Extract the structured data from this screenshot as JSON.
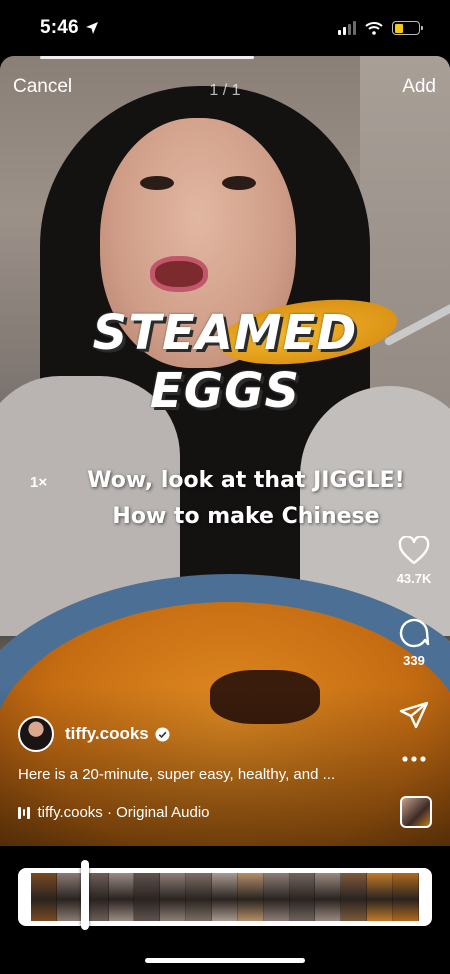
{
  "status_bar": {
    "time": "5:46",
    "battery_color": "#f5c518"
  },
  "top_bar": {
    "cancel_label": "Cancel",
    "page_counter": "1 / 1",
    "add_label": "Add"
  },
  "overlay": {
    "title_line1": "STEAMED",
    "title_line2": "EGGS",
    "speed_label": "1×",
    "caption_line1": "Wow, look at that JIGGLE!",
    "caption_line2": "How to make Chinese"
  },
  "actions": {
    "like_count": "43.7K",
    "comment_count": "339",
    "icons": [
      "heart-icon",
      "comment-icon",
      "share-icon",
      "more-icon"
    ]
  },
  "post": {
    "username": "tiffy.cooks",
    "verified": true,
    "caption": "Here is a 20-minute, super easy, healthy, and ...",
    "audio": "tiffy.cooks · Original Audio"
  },
  "timeline": {
    "frame_colors": [
      "#7a4a22",
      "#8a7c74",
      "#6e5f58",
      "#9a8c84",
      "#5e5450",
      "#8d7f77",
      "#7c6e66",
      "#a99b90",
      "#b38f6a",
      "#8c7d76",
      "#6f6560",
      "#9a8a80",
      "#7e5a3a",
      "#c27a2a",
      "#b06a20"
    ],
    "playhead_fraction": 0.14
  }
}
